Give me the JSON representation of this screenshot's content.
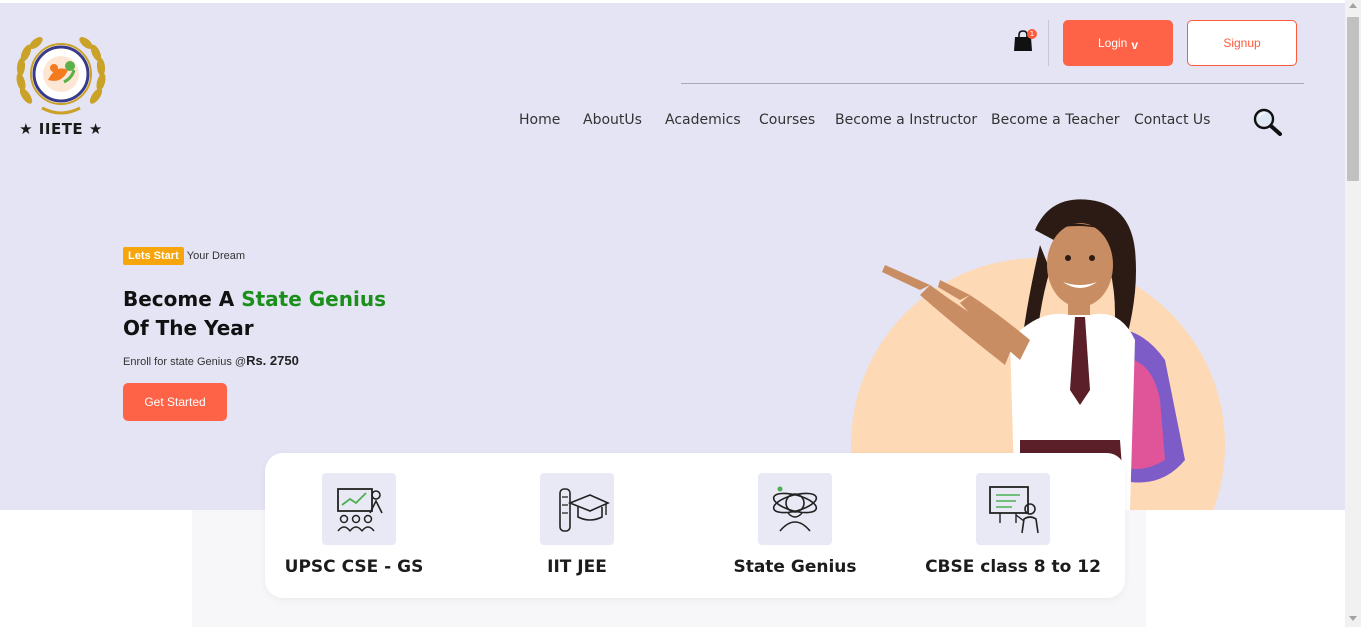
{
  "brand": {
    "logo_text": "★ IIETE ★"
  },
  "header": {
    "cart_count": "1",
    "login_label": "Login",
    "login_chevron": "v",
    "signup_label": "Signup"
  },
  "nav": {
    "items": [
      "Home",
      "AboutUs",
      "Academics",
      "Courses",
      "Become a Instructor",
      "Become a Teacher",
      "Contact Us"
    ]
  },
  "hero": {
    "tag_badge": "Lets Start",
    "tag_rest": "Your Dream",
    "headline_part1": "Become A ",
    "headline_highlight": "State Genius",
    "headline_line2": "Of The Year",
    "enroll_text": "Enroll for state Genius @",
    "enroll_price": "Rs. 2750",
    "cta_label": "Get Started"
  },
  "categories": [
    {
      "label": "UPSC CSE - GS",
      "icon": "classroom-teacher-icon"
    },
    {
      "label": "IIT JEE",
      "icon": "graduation-cap-scroll-icon"
    },
    {
      "label": "State Genius",
      "icon": "genius-brain-icon"
    },
    {
      "label": "CBSE class 8 to 12",
      "icon": "teacher-board-icon"
    }
  ],
  "colors": {
    "accent": "#ff6347",
    "hero_bg": "#e4e4f5",
    "highlight_green": "#1a8f1a",
    "tag_orange": "#f7a50c"
  }
}
